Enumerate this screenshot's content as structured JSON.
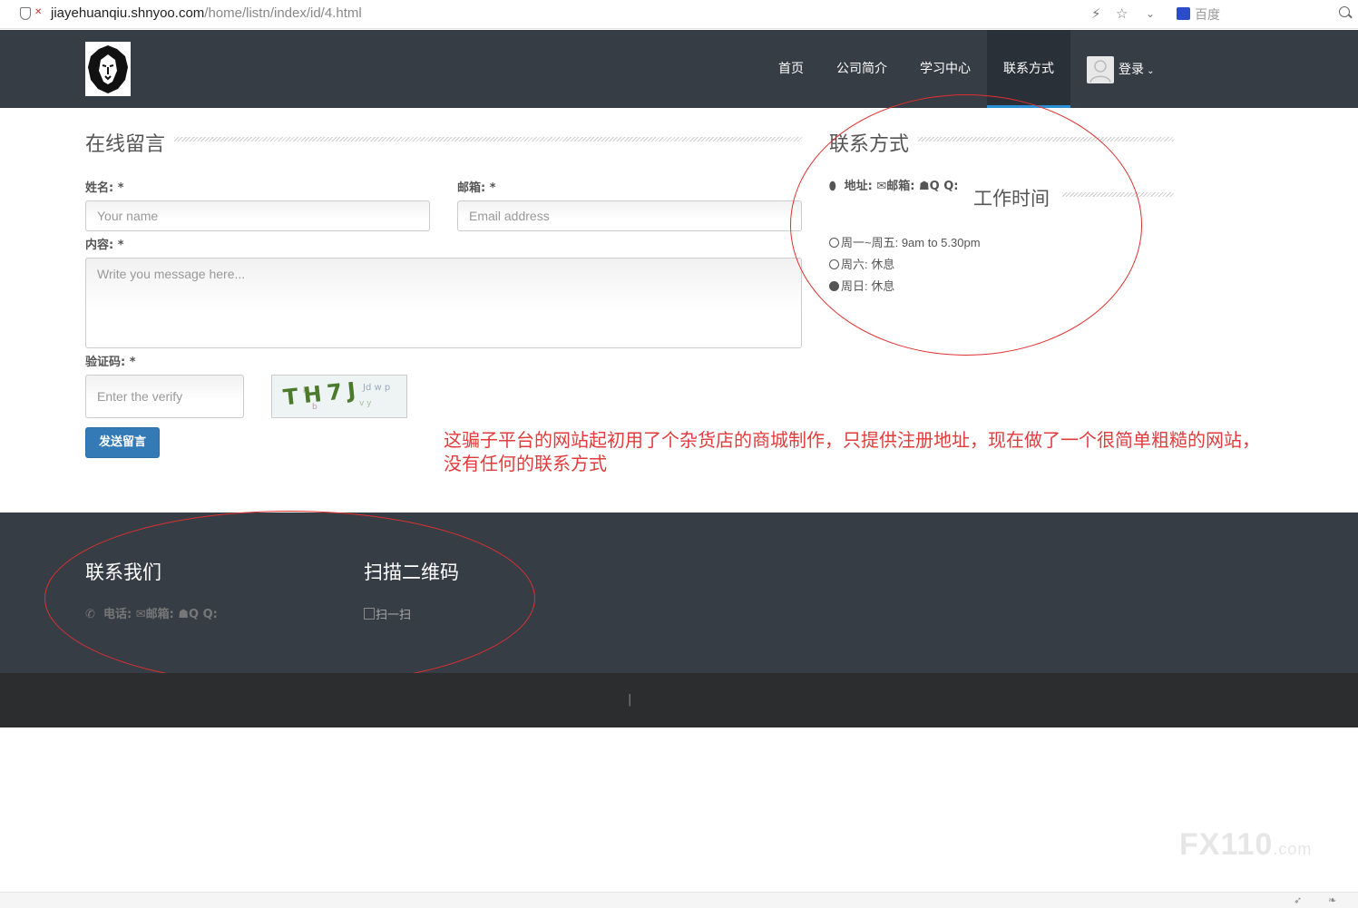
{
  "browser": {
    "url_domain": "jiayehuanqiu.shnyoo.com",
    "url_path": "/home/listn/index/id/4.html",
    "search_engine": "百度"
  },
  "navbar": {
    "items": [
      {
        "label": "首页"
      },
      {
        "label": "公司简介"
      },
      {
        "label": "学习中心"
      },
      {
        "label": "联系方式",
        "active": true
      }
    ],
    "login_label": "登录"
  },
  "message_form": {
    "title": "在线留言",
    "name_label": "姓名: *",
    "name_placeholder": "Your name",
    "email_label": "邮箱: *",
    "email_placeholder": "Email address",
    "content_label": "内容: *",
    "content_placeholder": "Write you message here...",
    "verify_label": "验证码: *",
    "verify_placeholder": "Enter the verify",
    "captcha_text": "TH7J",
    "submit_label": "发送留言"
  },
  "contact": {
    "title": "联系方式",
    "address_label": "地址:",
    "email_label": "邮箱:",
    "qq_label": "Q Q:",
    "work_hours_title": "工作时间",
    "hours": [
      {
        "icon": "clock-icon",
        "text": "周一~周五: 9am to 5.30pm"
      },
      {
        "icon": "clock-icon",
        "text": "周六: 休息"
      },
      {
        "icon": "times-circle-icon",
        "text": "周日: 休息"
      }
    ]
  },
  "annotation": {
    "text": "这骗子平台的网站起初用了个杂货店的商城制作，只提供注册地址，现在做了一个很简单粗糙的网站，没有任何的联系方式",
    "color": "#e23b3b"
  },
  "footer": {
    "contact_title": "联系我们",
    "phone_label": "电话:",
    "email_label": "邮箱:",
    "qq_label": "Q Q:",
    "qr_title": "扫描二维码",
    "qr_alt": "扫一扫",
    "separator": "|"
  },
  "watermark": {
    "main": "FX110",
    "suffix": ".com"
  },
  "colors": {
    "navbar": "#363d45",
    "accent": "#2b8fd6",
    "button": "#337ab7",
    "annotation": "#e23b3b"
  }
}
